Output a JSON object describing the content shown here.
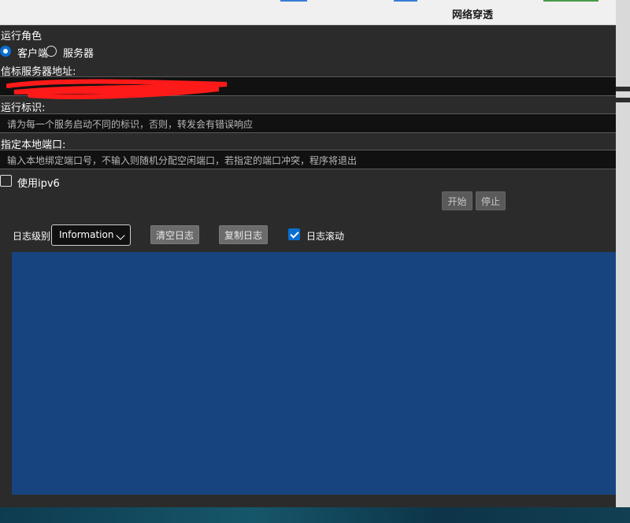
{
  "window": {
    "title": "网络穿透"
  },
  "role": {
    "heading": "运行角色",
    "options": [
      {
        "label": "客户端",
        "selected": true
      },
      {
        "label": "服务器",
        "selected": false
      }
    ]
  },
  "beacon": {
    "label": "信标服务器地址:",
    "value": ""
  },
  "run_id": {
    "label": "运行标识:",
    "placeholder": "请为每一个服务启动不同的标识，否则，转发会有错误响应"
  },
  "local_port": {
    "label": "指定本地端口:",
    "placeholder": "输入本地绑定端口号，不输入则随机分配空闲端口，若指定的端口冲突，程序将退出"
  },
  "ipv6": {
    "label": "使用ipv6",
    "checked": false
  },
  "actions": {
    "start": "开始",
    "stop": "停止"
  },
  "log": {
    "level_label": "日志级别:",
    "level_value": "Information",
    "clear": "清空日志",
    "copy": "复制日志",
    "scroll_label": "日志滚动",
    "scroll_checked": true,
    "area_color": "#17447f"
  },
  "icons": {
    "chevron": "chevron-down-icon",
    "check": "check-icon"
  }
}
